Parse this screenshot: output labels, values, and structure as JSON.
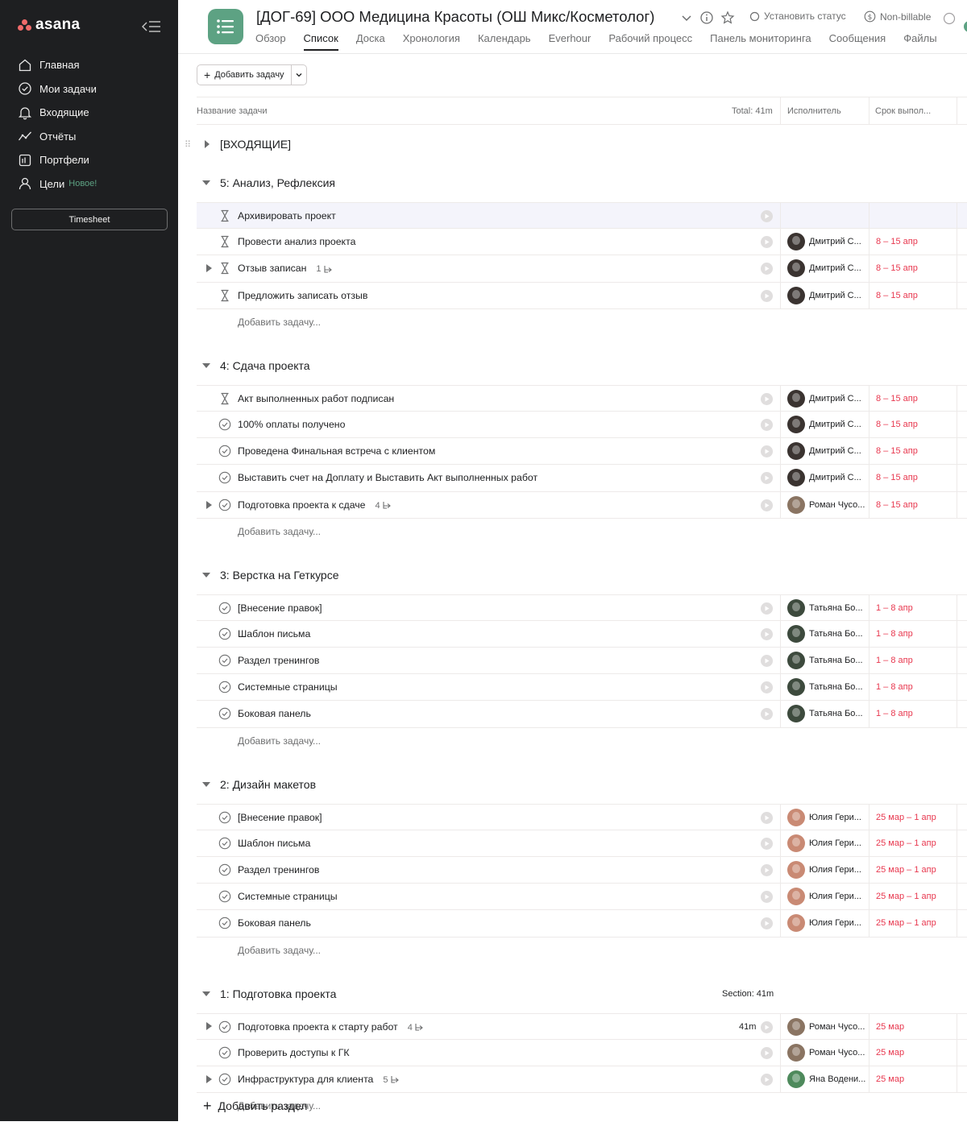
{
  "sidebar": {
    "logo": "asana",
    "nav": [
      {
        "label": "Главная",
        "icon": "home-icon"
      },
      {
        "label": "Мои задачи",
        "icon": "check-circle-icon"
      },
      {
        "label": "Входящие",
        "icon": "bell-icon"
      },
      {
        "label": "Отчёты",
        "icon": "chart-line-icon"
      },
      {
        "label": "Портфели",
        "icon": "portfolio-icon"
      },
      {
        "label": "Цели",
        "icon": "goals-icon",
        "badge": "Новое!"
      }
    ],
    "timesheet": "Timesheet"
  },
  "header": {
    "title": "[ДОГ-69] ООО Медицина Красоты (ОШ Микс/Косметолог)",
    "status_label": "Установить статус",
    "billable_label": "Non-billable",
    "tabs": [
      "Обзор",
      "Список",
      "Доска",
      "Хронология",
      "Календарь",
      "Everhour",
      "Рабочий процесс",
      "Панель мониторинга",
      "Сообщения",
      "Файлы"
    ],
    "active_tab": "Список"
  },
  "toolbar": {
    "add_task": "Добавить задачу"
  },
  "columns": {
    "name": "Название задачи",
    "total": "Total: 41m",
    "assignee": "Исполнитель",
    "due": "Срок выпол..."
  },
  "sections": {
    "inbox": {
      "title": "[ВХОДЯЩИЕ]"
    },
    "s5": {
      "title": "5: Анализ, Рефлексия",
      "tasks": [
        {
          "name": "Архивировать проект",
          "assignee": "",
          "due": ""
        },
        {
          "name": "Провести анализ проекта",
          "assignee": "Дмитрий С...",
          "due": "8 – 15 апр"
        },
        {
          "name": "Отзыв записан",
          "subtasks": "1",
          "assignee": "Дмитрий С...",
          "due": "8 – 15 апр"
        },
        {
          "name": "Предложить записать отзыв",
          "assignee": "Дмитрий С...",
          "due": "8 – 15 апр"
        }
      ]
    },
    "s4": {
      "title": "4: Сдача проекта",
      "tasks": [
        {
          "name": "Акт выполненных работ подписан",
          "assignee": "Дмитрий С...",
          "due": "8 – 15 апр"
        },
        {
          "name": "100% оплаты получено",
          "assignee": "Дмитрий С...",
          "due": "8 – 15 апр"
        },
        {
          "name": "Проведена Финальная встреча с клиентом",
          "assignee": "Дмитрий С...",
          "due": "8 – 15 апр"
        },
        {
          "name": "Выставить счет на Доплату и Выставить Акт выполненных работ",
          "assignee": "Дмитрий С...",
          "due": "8 – 15 апр"
        },
        {
          "name": "Подготовка проекта к сдаче",
          "subtasks": "4",
          "assignee": "Роман Чусо...",
          "due": "8 – 15 апр"
        }
      ]
    },
    "s3": {
      "title": "3: Верстка на Геткурсе",
      "tasks": [
        {
          "name": "[Внесение правок]",
          "assignee": "Татьяна Бо...",
          "due": "1 – 8 апр"
        },
        {
          "name": "Шаблон письма",
          "assignee": "Татьяна Бо...",
          "due": "1 – 8 апр"
        },
        {
          "name": "Раздел тренингов",
          "assignee": "Татьяна Бо...",
          "due": "1 – 8 апр"
        },
        {
          "name": "Системные страницы",
          "assignee": "Татьяна Бо...",
          "due": "1 – 8 апр"
        },
        {
          "name": "Боковая панель",
          "assignee": "Татьяна Бо...",
          "due": "1 – 8 апр"
        }
      ]
    },
    "s2": {
      "title": "2: Дизайн макетов",
      "tasks": [
        {
          "name": "[Внесение правок]",
          "assignee": "Юлия Гери...",
          "due": "25 мар – 1 апр"
        },
        {
          "name": "Шаблон письма",
          "assignee": "Юлия Гери...",
          "due": "25 мар – 1 апр"
        },
        {
          "name": "Раздел тренингов",
          "assignee": "Юлия Гери...",
          "due": "25 мар – 1 апр"
        },
        {
          "name": "Системные страницы",
          "assignee": "Юлия Гери...",
          "due": "25 мар – 1 апр"
        },
        {
          "name": "Боковая панель",
          "assignee": "Юлия Гери...",
          "due": "25 мар – 1 апр"
        }
      ]
    },
    "s1": {
      "title": "1: Подготовка проекта",
      "total": "Section: 41m",
      "tasks": [
        {
          "name": "Подготовка проекта к старту работ",
          "subtasks": "4",
          "time": "41m",
          "assignee": "Роман Чусо...",
          "due": "25 мар"
        },
        {
          "name": "Проверить доступы к ГК",
          "assignee": "Роман Чусо...",
          "due": "25 мар"
        },
        {
          "name": "Инфраструктура для клиента",
          "subtasks": "5",
          "assignee": "Яна Водени...",
          "due": "25 мар"
        }
      ]
    }
  },
  "add_task_row": "Добавить задачу...",
  "add_section": "Добавить раздел",
  "colors": {
    "sidebar_bg": "#1e1f21",
    "project_icon": "#5da283",
    "due_red": "#e8384f",
    "new_badge": "#5da283"
  }
}
